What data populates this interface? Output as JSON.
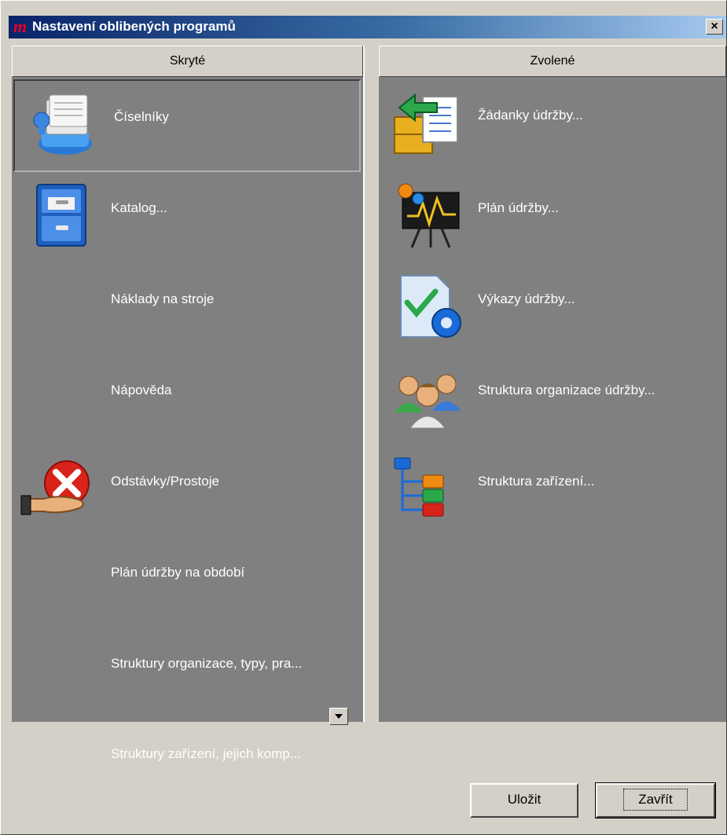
{
  "window": {
    "title": "Nastavení oblibených programů",
    "logo": "m",
    "close_label": "×"
  },
  "hidden_panel": {
    "header": "Skryté",
    "items": [
      {
        "label": "Číselníky",
        "icon": "card-file-icon",
        "selected": true
      },
      {
        "label": "Katalog...",
        "icon": "filing-cabinet-icon"
      },
      {
        "label": "Náklady na stroje",
        "icon": ""
      },
      {
        "label": "Nápověda",
        "icon": ""
      },
      {
        "label": "Odstávky/Prostoje",
        "icon": "stop-hand-icon"
      },
      {
        "label": "Plán údržby na období",
        "icon": ""
      },
      {
        "label": "Struktury organizace, typy, pra...",
        "icon": ""
      },
      {
        "label": "Struktury zařízení, jejich komp...",
        "icon": ""
      }
    ]
  },
  "selected_panel": {
    "header": "Zvolené",
    "items": [
      {
        "label": "Žádanky údržby...",
        "icon": "request-box-icon"
      },
      {
        "label": "Plán údržby...",
        "icon": "presentation-chart-icon"
      },
      {
        "label": "Výkazy údržby...",
        "icon": "report-document-icon"
      },
      {
        "label": "Struktura organizace údržby...",
        "icon": "people-group-icon"
      },
      {
        "label": "Struktura zařízení...",
        "icon": "tree-structure-icon"
      }
    ]
  },
  "buttons": {
    "save": "Uložit",
    "close": "Zavřít"
  }
}
